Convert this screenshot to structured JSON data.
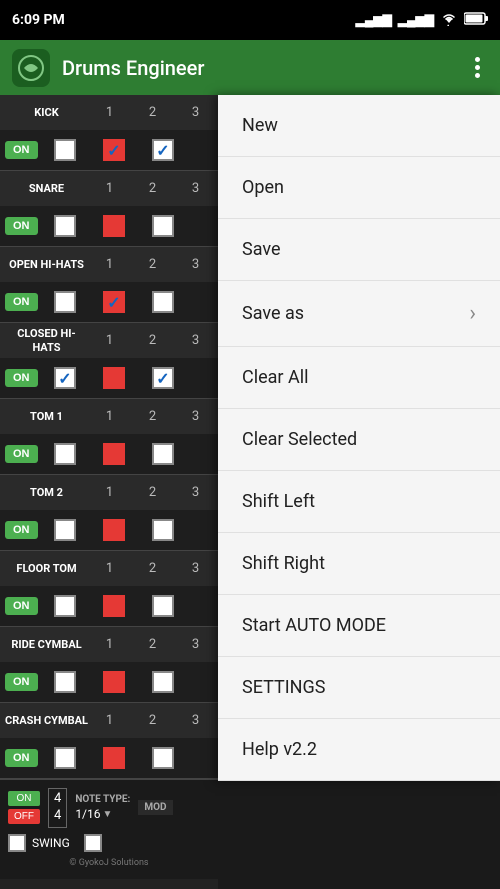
{
  "statusBar": {
    "time": "6:09 PM",
    "signalBars": "▂▄▆",
    "wifi": "WiFi",
    "battery": "🔋"
  },
  "topBar": {
    "title": "Drums Engineer",
    "menuLabel": "⋮"
  },
  "drumRows": [
    {
      "name": "KICK",
      "col1": "1",
      "col2": "2",
      "col3": "3",
      "onState": true,
      "beats": [
        "unchecked",
        "red-checked",
        "checked"
      ]
    },
    {
      "name": "SNARE",
      "col1": "1",
      "col2": "2",
      "col3": "3",
      "onState": true,
      "beats": [
        "unchecked",
        "red-unchecked",
        "unchecked"
      ]
    },
    {
      "name": "OPEN HI-HATS",
      "col1": "1",
      "col2": "2",
      "col3": "3",
      "onState": true,
      "beats": [
        "unchecked",
        "red-checked",
        "unchecked"
      ]
    },
    {
      "name": "CLOSED HI-HATS",
      "col1": "1",
      "col2": "2",
      "col3": "3",
      "onState": true,
      "beats": [
        "checked",
        "red-unchecked",
        "checked"
      ]
    },
    {
      "name": "TOM 1",
      "col1": "1",
      "col2": "2",
      "col3": "3",
      "onState": true,
      "beats": [
        "unchecked",
        "red-unchecked",
        "unchecked"
      ]
    },
    {
      "name": "TOM 2",
      "col1": "1",
      "col2": "2",
      "col3": "3",
      "onState": true,
      "beats": [
        "unchecked",
        "red-unchecked",
        "unchecked"
      ]
    },
    {
      "name": "FLOOR TOM",
      "col1": "1",
      "col2": "2",
      "col3": "3",
      "onState": true,
      "beats": [
        "unchecked",
        "red-unchecked",
        "unchecked"
      ]
    },
    {
      "name": "RIDE CYMBAL",
      "col1": "1",
      "col2": "2",
      "col3": "3",
      "onState": true,
      "beats": [
        "unchecked",
        "red-unchecked",
        "unchecked"
      ]
    },
    {
      "name": "CRASH CYMBAL",
      "col1": "1",
      "col2": "2",
      "col3": "3",
      "onState": true,
      "beats": [
        "unchecked",
        "red-unchecked",
        "unchecked"
      ]
    }
  ],
  "bottomControls": {
    "timeSignatureTop": "4",
    "timeSignatureBottom": "4",
    "noteTypeLabel": "NOTE TYPE:",
    "noteValue": "1/16",
    "modeLabel": "MOD",
    "onLabel": "ON",
    "offLabel": "OFF",
    "swingLabel": "SWING"
  },
  "dropdownMenu": {
    "items": [
      {
        "label": "New",
        "hasArrow": false
      },
      {
        "label": "Open",
        "hasArrow": false
      },
      {
        "label": "Save",
        "hasArrow": false
      },
      {
        "label": "Save as",
        "hasArrow": true
      },
      {
        "label": "Clear All",
        "hasArrow": false
      },
      {
        "label": "Clear Selected",
        "hasArrow": false
      },
      {
        "label": "Shift Left",
        "hasArrow": false
      },
      {
        "label": "Shift Right",
        "hasArrow": false
      },
      {
        "label": "Start AUTO MODE",
        "hasArrow": false
      },
      {
        "label": "SETTINGS",
        "hasArrow": false
      },
      {
        "label": "Help v2.2",
        "hasArrow": false
      }
    ]
  },
  "copyright": "© GyokoJ Solutions"
}
